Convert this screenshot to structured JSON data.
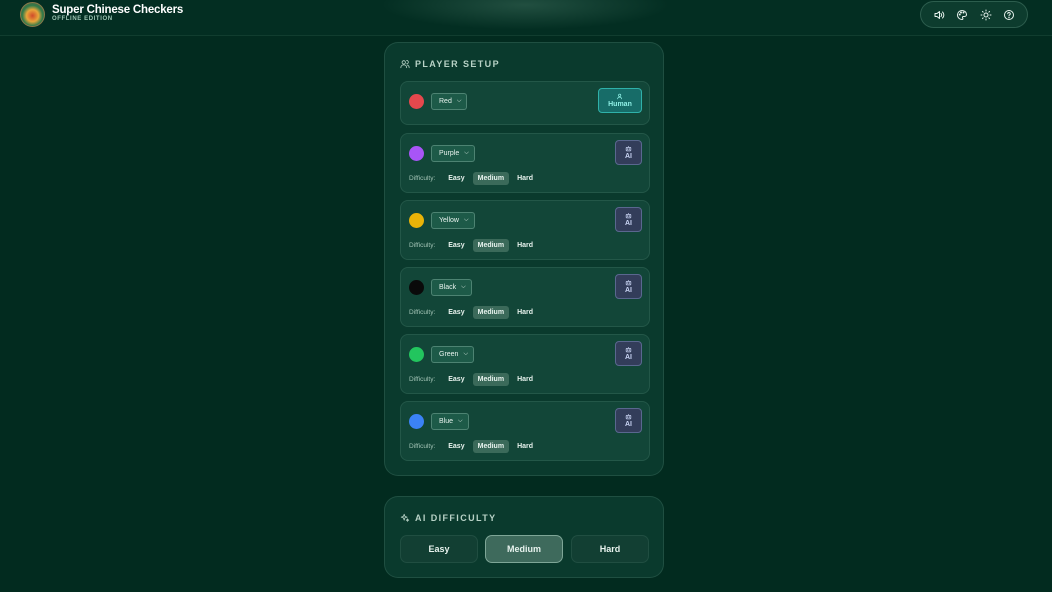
{
  "app": {
    "title": "Super Chinese Checkers",
    "subtitle": "OFFLINE EDITION"
  },
  "toolbar": {
    "icons": [
      "speaker-icon",
      "palette-icon",
      "sun-icon",
      "help-icon"
    ]
  },
  "player_setup": {
    "heading": "PLAYER SETUP",
    "difficulty_label": "Difficulty:",
    "difficulty_options": [
      "Easy",
      "Medium",
      "Hard"
    ],
    "players": [
      {
        "color_name": "Red",
        "color": "#e5484d",
        "type": "Human",
        "difficulty": null
      },
      {
        "color_name": "Purple",
        "color": "#a855f7",
        "type": "AI",
        "difficulty": "Medium"
      },
      {
        "color_name": "Yellow",
        "color": "#eab308",
        "type": "AI",
        "difficulty": "Medium"
      },
      {
        "color_name": "Black",
        "color": "#0a0a0a",
        "type": "AI",
        "difficulty": "Medium"
      },
      {
        "color_name": "Green",
        "color": "#22c55e",
        "type": "AI",
        "difficulty": "Medium"
      },
      {
        "color_name": "Blue",
        "color": "#3b82f6",
        "type": "AI",
        "difficulty": "Medium"
      }
    ]
  },
  "ai_difficulty": {
    "heading": "AI DIFFICULTY",
    "options": [
      "Easy",
      "Medium",
      "Hard"
    ],
    "selected": "Medium"
  },
  "colors": {
    "background": "#022b1f",
    "panel": "#0a3a2d",
    "card": "#124638",
    "human_accent": "#2fb1a9",
    "ai_accent": "#5a678f"
  }
}
